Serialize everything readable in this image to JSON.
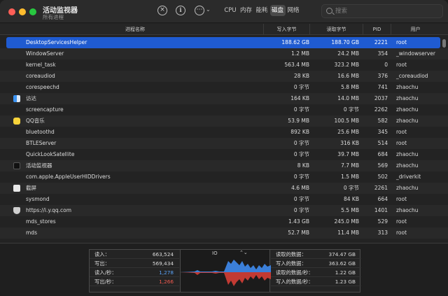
{
  "window": {
    "title": "活动监视器",
    "subtitle": "所有进程"
  },
  "toolbar": {
    "stop_glyph": "×",
    "info_glyph": "i",
    "more_glyph": "⋯",
    "chevron_glyph": "⌄"
  },
  "tabs": [
    {
      "label": "CPU",
      "active": false
    },
    {
      "label": "内存",
      "active": false
    },
    {
      "label": "能耗",
      "active": false
    },
    {
      "label": "磁盘",
      "active": true
    },
    {
      "label": "网络",
      "active": false
    }
  ],
  "search": {
    "placeholder": "搜索"
  },
  "columns": {
    "name": "进程名称",
    "written": "写入字节",
    "read": "读取字节",
    "pid": "PID",
    "user": "用户"
  },
  "rows": [
    {
      "name": "DesktopServicesHelper",
      "written": "188.62 GB",
      "read": "188.70 GB",
      "pid": "2221",
      "user": "root",
      "icon": "",
      "selected": true
    },
    {
      "name": "WindowServer",
      "written": "1.2 MB",
      "read": "24.2 MB",
      "pid": "354",
      "user": "_windowserver",
      "icon": ""
    },
    {
      "name": "kernel_task",
      "written": "563.4 MB",
      "read": "323.2 MB",
      "pid": "0",
      "user": "root",
      "icon": ""
    },
    {
      "name": "coreaudiod",
      "written": "28 KB",
      "read": "16.6 MB",
      "pid": "376",
      "user": "_coreaudiod",
      "icon": ""
    },
    {
      "name": "corespeechd",
      "written": "0 字节",
      "read": "5.8 MB",
      "pid": "741",
      "user": "zhaochu",
      "icon": ""
    },
    {
      "name": "访达",
      "written": "164 KB",
      "read": "14.0 MB",
      "pid": "2037",
      "user": "zhaochu",
      "icon": "finder"
    },
    {
      "name": "screencapture",
      "written": "0 字节",
      "read": "0 字节",
      "pid": "2262",
      "user": "zhaochu",
      "icon": ""
    },
    {
      "name": "QQ音乐",
      "written": "53.9 MB",
      "read": "100.5 MB",
      "pid": "582",
      "user": "zhaochu",
      "icon": "qq"
    },
    {
      "name": "bluetoothd",
      "written": "892 KB",
      "read": "25.6 MB",
      "pid": "345",
      "user": "root",
      "icon": ""
    },
    {
      "name": "BTLEServer",
      "written": "0 字节",
      "read": "316 KB",
      "pid": "514",
      "user": "root",
      "icon": ""
    },
    {
      "name": "QuickLookSatellite",
      "written": "0 字节",
      "read": "39.7 MB",
      "pid": "684",
      "user": "zhaochu",
      "icon": ""
    },
    {
      "name": "活动监视器",
      "written": "8 KB",
      "read": "7.7 MB",
      "pid": "569",
      "user": "zhaochu",
      "icon": "am"
    },
    {
      "name": "com.apple.AppleUserHIDDrivers",
      "written": "0 字节",
      "read": "1.5 MB",
      "pid": "502",
      "user": "_driverkit",
      "icon": ""
    },
    {
      "name": "截屏",
      "written": "4.6 MB",
      "read": "0 字节",
      "pid": "2261",
      "user": "zhaochu",
      "icon": "shot"
    },
    {
      "name": "sysmond",
      "written": "0 字节",
      "read": "84 KB",
      "pid": "664",
      "user": "root",
      "icon": ""
    },
    {
      "name": "https://i.y.qq.com",
      "written": "0 字节",
      "read": "5.5 MB",
      "pid": "1401",
      "user": "zhaochu",
      "icon": "shield"
    },
    {
      "name": "mds_stores",
      "written": "1.43 GB",
      "read": "245.0 MB",
      "pid": "529",
      "user": "root",
      "icon": ""
    },
    {
      "name": "mds",
      "written": "52.7 MB",
      "read": "11.4 MB",
      "pid": "313",
      "user": "root",
      "icon": ""
    }
  ],
  "stats_left": [
    {
      "label": "读入：",
      "value": "663,524",
      "tone": ""
    },
    {
      "label": "写出：",
      "value": "569,434",
      "tone": ""
    },
    {
      "label": "读入/秒：",
      "value": "1,278",
      "tone": "blue"
    },
    {
      "label": "写出/秒：",
      "value": "1,266",
      "tone": "red"
    }
  ],
  "graph": {
    "selector": "IO",
    "chevron": "⌃⌄",
    "read_color": "#3b7fd9",
    "write_color": "#c23a33"
  },
  "stats_right": [
    {
      "label": "读取的数据：",
      "value": "374.47 GB",
      "tone": ""
    },
    {
      "label": "写入的数据：",
      "value": "363.62 GB",
      "tone": ""
    },
    {
      "label": "读取的数据/秒：",
      "value": "1.22 GB",
      "tone": ""
    },
    {
      "label": "写入的数据/秒：",
      "value": "1.23 GB",
      "tone": ""
    }
  ]
}
